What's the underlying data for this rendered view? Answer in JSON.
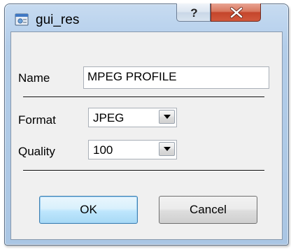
{
  "window": {
    "title": "gui_res",
    "app_icon": "app-window-icon",
    "help_icon": "question-mark-icon",
    "close_icon": "close-x-icon"
  },
  "form": {
    "name_label": "Name",
    "name_value": "MPEG PROFILE",
    "format_label": "Format",
    "format_value": "JPEG",
    "quality_label": "Quality",
    "quality_value": "100"
  },
  "buttons": {
    "ok_label": "OK",
    "cancel_label": "Cancel"
  },
  "colors": {
    "frame": "#b9d1ea",
    "close_button": "#c7462c",
    "ok_button_accent": "#3c7fb1",
    "client_background": "#f0f0f0"
  }
}
